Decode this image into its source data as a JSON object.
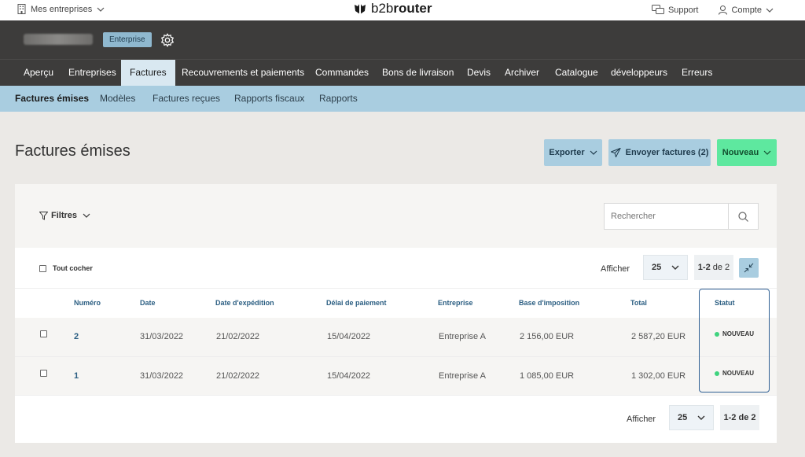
{
  "topbar": {
    "companies_label": "Mes entreprises",
    "logo_prefix": "b2b",
    "logo_suffix": "router",
    "support_label": "Support",
    "account_label": "Compte"
  },
  "company": {
    "badge": "Enterprise"
  },
  "main_nav": {
    "tabs": [
      "Aperçu",
      "Entreprises",
      "Factures",
      "Recouvrements et paiements",
      "Commandes",
      "Bons de livraison",
      "Devis",
      "Archiver",
      "Catalogue",
      "développeurs",
      "Erreurs"
    ],
    "active": "Factures"
  },
  "sub_nav": {
    "tabs": [
      "Factures émises",
      "Modèles",
      "Factures reçues",
      "Rapports fiscaux",
      "Rapports"
    ],
    "active": "Factures émises"
  },
  "page": {
    "title": "Factures émises",
    "export_label": "Exporter",
    "send_label": "Envoyer factures (2)",
    "new_label": "Nouveau"
  },
  "filters": {
    "label": "Filtres",
    "search_placeholder": "Rechercher"
  },
  "toolbar": {
    "check_all_label": "Tout cocher",
    "show_label": "Afficher",
    "per_page": "25",
    "pager_range": "1-2",
    "pager_of": "de 2"
  },
  "table": {
    "columns": [
      "Numéro",
      "Date",
      "Date d'expédition",
      "Délai de paiement",
      "Entreprise",
      "Base d'imposition",
      "Total",
      "Statut"
    ],
    "rows": [
      {
        "number": "2",
        "date": "31/03/2022",
        "ship_date": "21/02/2022",
        "due": "15/04/2022",
        "company": "Entreprise A",
        "base": "2 156,00 EUR",
        "total": "2 587,20 EUR",
        "status": "NOUVEAU"
      },
      {
        "number": "1",
        "date": "31/03/2022",
        "ship_date": "21/02/2022",
        "due": "15/04/2022",
        "company": "Entreprise A",
        "base": "1 085,00 EUR",
        "total": "1 302,00 EUR",
        "status": "NOUVEAU"
      }
    ]
  },
  "bottom": {
    "show_label": "Afficher",
    "per_page": "25",
    "pager_range": "1-2",
    "pager_of": "de 2"
  },
  "colors": {
    "dark_bar": "#3d3c3b",
    "light_blue": "#a9cde0",
    "accent_green": "#5ee89f",
    "status_dot": "#3fd37e",
    "link_blue": "#2b5e82"
  }
}
